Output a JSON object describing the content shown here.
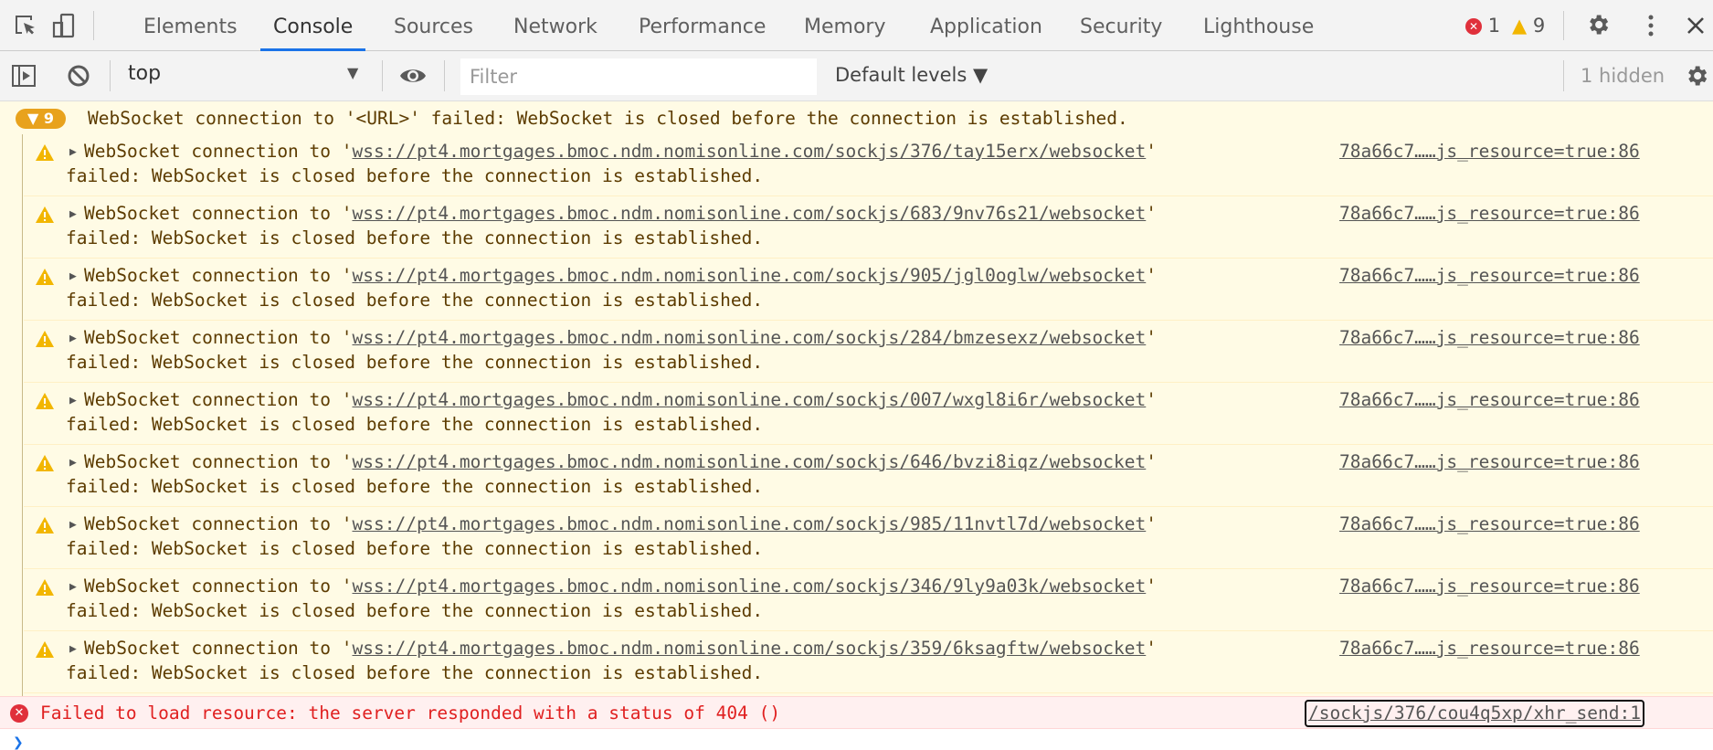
{
  "tabs": [
    {
      "label": "Elements",
      "active": false
    },
    {
      "label": "Console",
      "active": true
    },
    {
      "label": "Sources",
      "active": false
    },
    {
      "label": "Network",
      "active": false
    },
    {
      "label": "Performance",
      "active": false
    },
    {
      "label": "Memory",
      "active": false
    },
    {
      "label": "Application",
      "active": false
    },
    {
      "label": "Security",
      "active": false
    },
    {
      "label": "Lighthouse",
      "active": false
    }
  ],
  "status": {
    "errors": "1",
    "warnings": "9"
  },
  "icons": {
    "inspect": "inspect-element-icon",
    "device": "device-toolbar-icon",
    "settings": "gear-icon",
    "more": "kebab-menu-icon",
    "close": "close-icon",
    "sidebar": "show-sidebar-icon",
    "clear": "clear-console-icon",
    "eye": "live-expression-eye-icon"
  },
  "toolbar": {
    "context": "top",
    "filter_placeholder": "Filter",
    "levels": "Default levels ▼",
    "hidden": "1 hidden"
  },
  "colors": {
    "accent": "#1a73e8",
    "warning_bg": "#fffbe5",
    "warning_text": "#5c3b00",
    "error_bg": "#fff0f0",
    "error_text": "#e02020",
    "badge": "#e8a21d"
  },
  "group": {
    "count": "▼ 9",
    "text": "WebSocket connection to '<URL>' failed: WebSocket is closed before the connection is established."
  },
  "messages": [
    {
      "prefix": "WebSocket connection to '",
      "url": "wss://pt4.mortgages.bmoc.ndm.nomisonline.com/sockjs/376/tay15erx/websocket",
      "suffix": "'",
      "line2": "failed: WebSocket is closed before the connection is established.",
      "source": "78a66c7……js_resource=true:86"
    },
    {
      "prefix": "WebSocket connection to '",
      "url": "wss://pt4.mortgages.bmoc.ndm.nomisonline.com/sockjs/683/9nv76s21/websocket",
      "suffix": "'",
      "line2": "failed: WebSocket is closed before the connection is established.",
      "source": "78a66c7……js_resource=true:86"
    },
    {
      "prefix": "WebSocket connection to '",
      "url": "wss://pt4.mortgages.bmoc.ndm.nomisonline.com/sockjs/905/jgl0oglw/websocket",
      "suffix": "'",
      "line2": "failed: WebSocket is closed before the connection is established.",
      "source": "78a66c7……js_resource=true:86"
    },
    {
      "prefix": "WebSocket connection to '",
      "url": "wss://pt4.mortgages.bmoc.ndm.nomisonline.com/sockjs/284/bmzesexz/websocket",
      "suffix": "'",
      "line2": "failed: WebSocket is closed before the connection is established.",
      "source": "78a66c7……js_resource=true:86"
    },
    {
      "prefix": "WebSocket connection to '",
      "url": "wss://pt4.mortgages.bmoc.ndm.nomisonline.com/sockjs/007/wxgl8i6r/websocket",
      "suffix": "'",
      "line2": "failed: WebSocket is closed before the connection is established.",
      "source": "78a66c7……js_resource=true:86"
    },
    {
      "prefix": "WebSocket connection to '",
      "url": "wss://pt4.mortgages.bmoc.ndm.nomisonline.com/sockjs/646/bvzi8iqz/websocket",
      "suffix": "'",
      "line2": "failed: WebSocket is closed before the connection is established.",
      "source": "78a66c7……js_resource=true:86"
    },
    {
      "prefix": "WebSocket connection to '",
      "url": "wss://pt4.mortgages.bmoc.ndm.nomisonline.com/sockjs/985/11nvtl7d/websocket",
      "suffix": "'",
      "line2": "failed: WebSocket is closed before the connection is established.",
      "source": "78a66c7……js_resource=true:86"
    },
    {
      "prefix": "WebSocket connection to '",
      "url": "wss://pt4.mortgages.bmoc.ndm.nomisonline.com/sockjs/346/9ly9a03k/websocket",
      "suffix": "'",
      "line2": "failed: WebSocket is closed before the connection is established.",
      "source": "78a66c7……js_resource=true:86"
    },
    {
      "prefix": "WebSocket connection to '",
      "url": "wss://pt4.mortgages.bmoc.ndm.nomisonline.com/sockjs/359/6ksagftw/websocket",
      "suffix": "'",
      "line2": "failed: WebSocket is closed before the connection is established.",
      "source": "78a66c7……js_resource=true:86"
    }
  ],
  "error": {
    "text": "Failed to load resource: the server responded with a status of 404 ()",
    "source": "/sockjs/376/cou4q5xp/xhr_send:1",
    "icon_glyph": "✕"
  },
  "prompt": "❯"
}
